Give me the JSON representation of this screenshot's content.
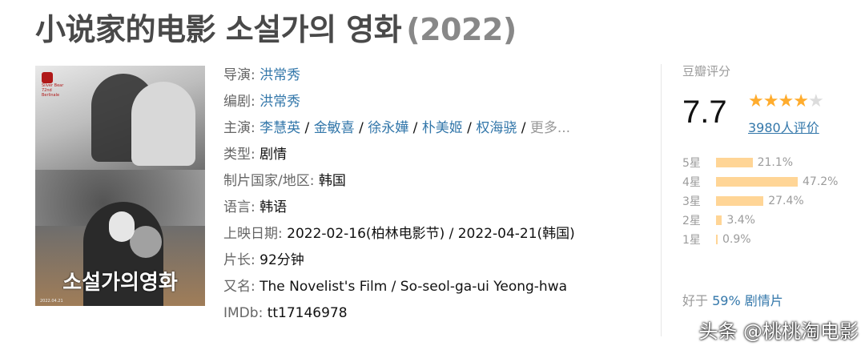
{
  "title": {
    "name": "小说家的电影 소설가의 영화",
    "year": "(2022)"
  },
  "poster": {
    "title_text": "소설가의영화",
    "festival_text": "Silver Bear 72nd Berlinale",
    "footer_text": "2022.04.21"
  },
  "info": {
    "director": {
      "label": "导演:",
      "names": [
        "洪常秀"
      ]
    },
    "writer": {
      "label": "编剧:",
      "names": [
        "洪常秀"
      ]
    },
    "cast": {
      "label": "主演:",
      "names": [
        "李慧英",
        "金敏喜",
        "徐永嬅",
        "朴美姬",
        "权海骁"
      ],
      "sep": " / ",
      "more": "更多..."
    },
    "genre": {
      "label": "类型:",
      "value": "剧情"
    },
    "country": {
      "label": "制片国家/地区:",
      "value": "韩国"
    },
    "language": {
      "label": "语言:",
      "value": "韩语"
    },
    "release": {
      "label": "上映日期:",
      "value": "2022-02-16(柏林电影节) / 2022-04-21(韩国)"
    },
    "runtime": {
      "label": "片长:",
      "value": "92分钟"
    },
    "aka": {
      "label": "又名:",
      "value": "The Novelist's Film / So-seol-ga-ui Yeong-hwa"
    },
    "imdb": {
      "label": "IMDb:",
      "value": "tt17146978"
    }
  },
  "rating": {
    "header": "豆瓣评分",
    "score": "7.7",
    "stars_filled": 4,
    "stars_total": 5,
    "count": "3980人评价",
    "star_color": "#ffac2d",
    "bar_color": "#ffd596",
    "distribution": [
      {
        "label": "5星",
        "pct": 21.1,
        "text": "21.1%"
      },
      {
        "label": "4星",
        "pct": 47.2,
        "text": "47.2%"
      },
      {
        "label": "3星",
        "pct": 27.4,
        "text": "27.4%"
      },
      {
        "label": "2星",
        "pct": 3.4,
        "text": "3.4%"
      },
      {
        "label": "1星",
        "pct": 0.9,
        "text": "0.9%"
      }
    ],
    "better_than": {
      "prefix": "好于",
      "link": "59% 剧情片"
    }
  },
  "watermark": "头条 @桃桃淘电影",
  "link_color": "#3377aa"
}
